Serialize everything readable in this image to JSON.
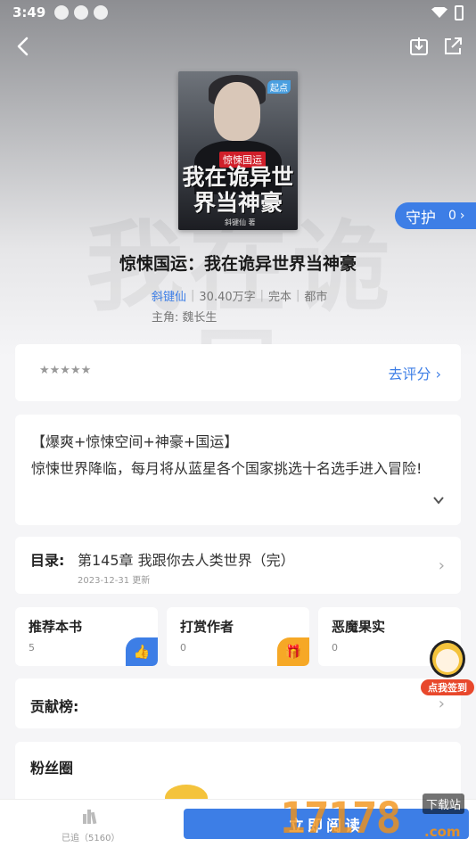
{
  "status_bar": {
    "time": "3:49"
  },
  "book": {
    "cover_tag": "惊悚国运",
    "cover_title": "我在诡异世界当神豪",
    "cover_author": "斜键仙 著",
    "cover_badge": "起点",
    "title": "惊悚国运：我在诡异世界当神豪",
    "author": "斜键仙",
    "word_count": "30.40万字",
    "status": "完本",
    "category": "都市",
    "protagonist_label": "主角:",
    "protagonist": "魏长生",
    "watermark": "我在诡异"
  },
  "guard": {
    "label": "守护",
    "count": "0"
  },
  "rating": {
    "stars": "★★★★★",
    "link": "去评分"
  },
  "intro": {
    "tags": "【爆爽+惊悚空间+神豪+国运】",
    "text": "惊悚世界降临，每月将从蓝星各个国家挑选十名选手进入冒险!"
  },
  "toc": {
    "label": "目录:",
    "latest_chapter": "第145章 我跟你去人类世界（完）",
    "updated": "2023-12-31 更新"
  },
  "mini_cards": [
    {
      "title": "推荐本书",
      "count": "5",
      "icon": "thumbs-up-icon",
      "color": "#3d7ee6"
    },
    {
      "title": "打赏作者",
      "count": "0",
      "icon": "gift-icon",
      "color": "#f6a826"
    },
    {
      "title": "恶魔果实",
      "count": "0",
      "icon": "fruit-icon",
      "color": "#e8482c"
    }
  ],
  "contrib": {
    "label": "贡献榜:"
  },
  "fans": {
    "label": "粉丝圈"
  },
  "signin": {
    "label": "点我签到"
  },
  "bottom": {
    "shelf_label": "已追（5160）",
    "read_button": "立即阅读"
  },
  "watermark": {
    "digits": "17178",
    "tag": "下载站",
    "suffix": ".com"
  },
  "colors": {
    "accent": "#3d7ee6",
    "background": "#f5f5f7"
  }
}
